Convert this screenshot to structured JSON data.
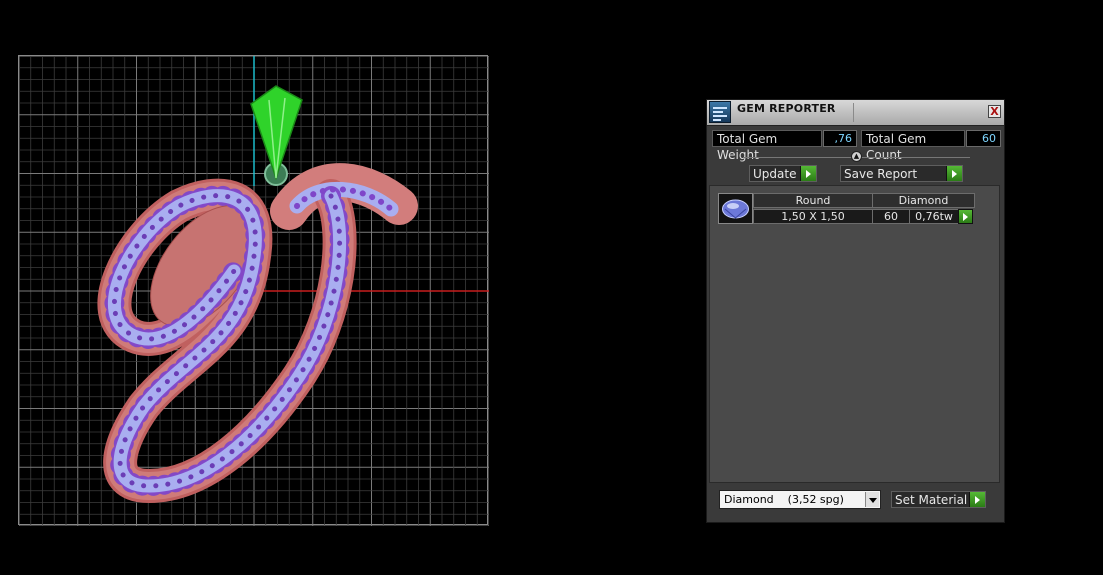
{
  "panel": {
    "title": "GEM REPORTER",
    "close_symbol": "X",
    "total_weight_label": "Total Gem Weight",
    "total_weight_value": ",76",
    "total_count_label": "Total Gem Count",
    "total_count_value": "60",
    "update_label": "Update",
    "save_report_label": "Save Report",
    "table": {
      "headers": [
        "Round",
        "Diamond"
      ],
      "row": {
        "size": "1,50 X 1,50",
        "count": "60",
        "weight": "0,76tw"
      }
    },
    "material_selected": "Diamond    (3,52 spg)",
    "set_material_label": "Set Material"
  },
  "icons": [
    "gem-reporter-icon",
    "close-icon",
    "collapse-icon",
    "arrow-right-icon",
    "round-gem-icon",
    "dropdown-arrow-icon"
  ],
  "colors": {
    "go_button": "#3f9e25",
    "value_text": "#7fd6ff",
    "pendant_body": "#c8706f",
    "gems": "#7f46c9",
    "bail": "#2fd32a",
    "axis_x": "#c81e1e",
    "axis_y": "#1ec8d8"
  }
}
